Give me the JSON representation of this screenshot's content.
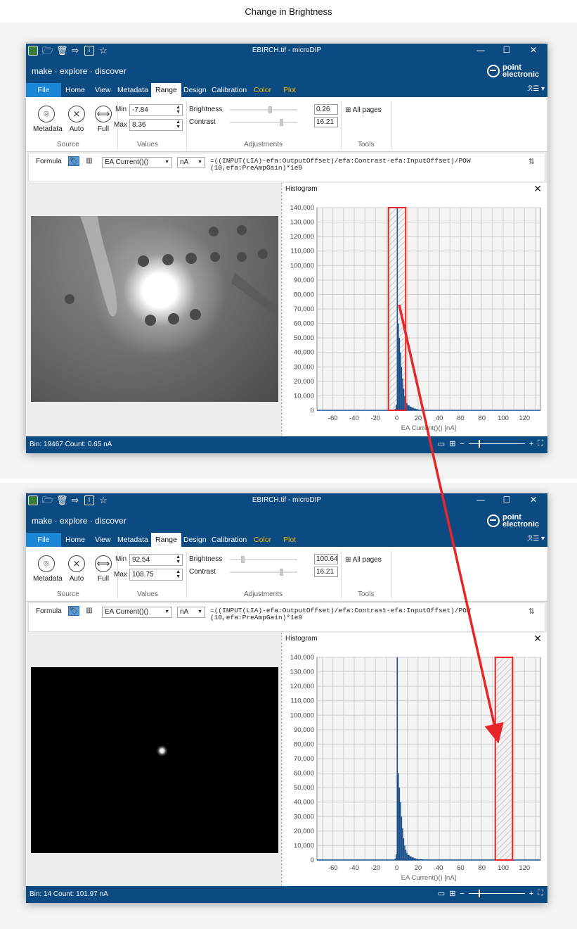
{
  "caption": "Change in Brightness",
  "window_title": "EBIRCH.tif - microDIP",
  "tagline": "make · explore · discover",
  "logo": {
    "line1": "point",
    "line2": "electronic"
  },
  "tabs": [
    "File",
    "Home",
    "View",
    "Metadata",
    "Range",
    "Design",
    "Calibration",
    "Color",
    "Plot"
  ],
  "active_tab": "Range",
  "accent_color": "#0c4a82",
  "file_tab_color": "#1b86d6",
  "highlight_color": "#e8262a",
  "ribbon": {
    "source": {
      "label": "Source",
      "buttons": [
        "Metadata",
        "Auto",
        "Full"
      ]
    },
    "values": {
      "label": "Values",
      "min_label": "Min",
      "max_label": "Max"
    },
    "adjustments": {
      "label": "Adjustments",
      "brightness_label": "Brightness",
      "contrast_label": "Contrast"
    },
    "tools": {
      "label": "Tools",
      "all_pages": "All pages"
    }
  },
  "formula_bar": {
    "label": "Formula",
    "channel": "EA Current()()",
    "unit": "nA",
    "formula_line1": "=((INPUT(LIA)-efa:OutputOffset)/efa:Contrast-efa:InputOffset)/POW",
    "formula_line2": "(10,efa:PreAmpGain)*1e9"
  },
  "histogram": {
    "title": "Histogram",
    "xlabel": "EA Current()() [nA]",
    "x_ticks": [
      -60,
      -40,
      -20,
      0,
      20,
      40,
      60,
      80,
      100,
      120
    ],
    "y_ticks": [
      "0",
      "10,000",
      "20,000",
      "30,000",
      "40,000",
      "50,000",
      "60,000",
      "70,000",
      "80,000",
      "90,000",
      "100,000",
      "110,000",
      "120,000",
      "130,000",
      "140,000"
    ]
  },
  "windows": [
    {
      "min": "-7.84",
      "max": "8.36",
      "brightness": "0.26",
      "contrast": "16.21",
      "brightness_level": 0.6,
      "contrast_level": 0.78,
      "status": "Bin: 19467  Count: 0.65 nA",
      "image_mode": "bright",
      "chart_data": {
        "type": "bar",
        "x_range": [
          -75,
          135
        ],
        "y_range": [
          0,
          140000
        ],
        "series": [
          {
            "x": [
              -2,
              -1,
              0,
              1,
              2,
              3,
              4,
              5,
              6,
              7,
              8,
              9,
              10,
              12,
              14,
              16,
              18,
              20,
              25,
              30
            ],
            "y": [
              1000,
              4000,
              140000,
              60000,
              50000,
              40000,
              30000,
              22000,
              15000,
              10000,
              7000,
              5000,
              3500,
              2500,
              1800,
              1200,
              800,
              500,
              300,
              100
            ]
          }
        ],
        "selection": [
          -7.84,
          8.36
        ]
      }
    },
    {
      "min": "92.54",
      "max": "108.75",
      "brightness": "100.64",
      "contrast": "16.21",
      "brightness_level": 0.18,
      "contrast_level": 0.78,
      "status": "Bin: 14 Count: 101.97 nA",
      "image_mode": "dark",
      "chart_data": {
        "type": "bar",
        "x_range": [
          -75,
          135
        ],
        "y_range": [
          0,
          140000
        ],
        "series": [
          {
            "x": [
              -2,
              -1,
              0,
              1,
              2,
              3,
              4,
              5,
              6,
              7,
              8,
              9,
              10,
              12,
              14,
              16,
              18,
              20,
              25,
              30
            ],
            "y": [
              1000,
              4000,
              140000,
              60000,
              50000,
              40000,
              30000,
              22000,
              15000,
              10000,
              7000,
              5000,
              3500,
              2500,
              1800,
              1200,
              800,
              500,
              300,
              100
            ]
          }
        ],
        "selection": [
          92.54,
          108.75
        ]
      }
    }
  ]
}
